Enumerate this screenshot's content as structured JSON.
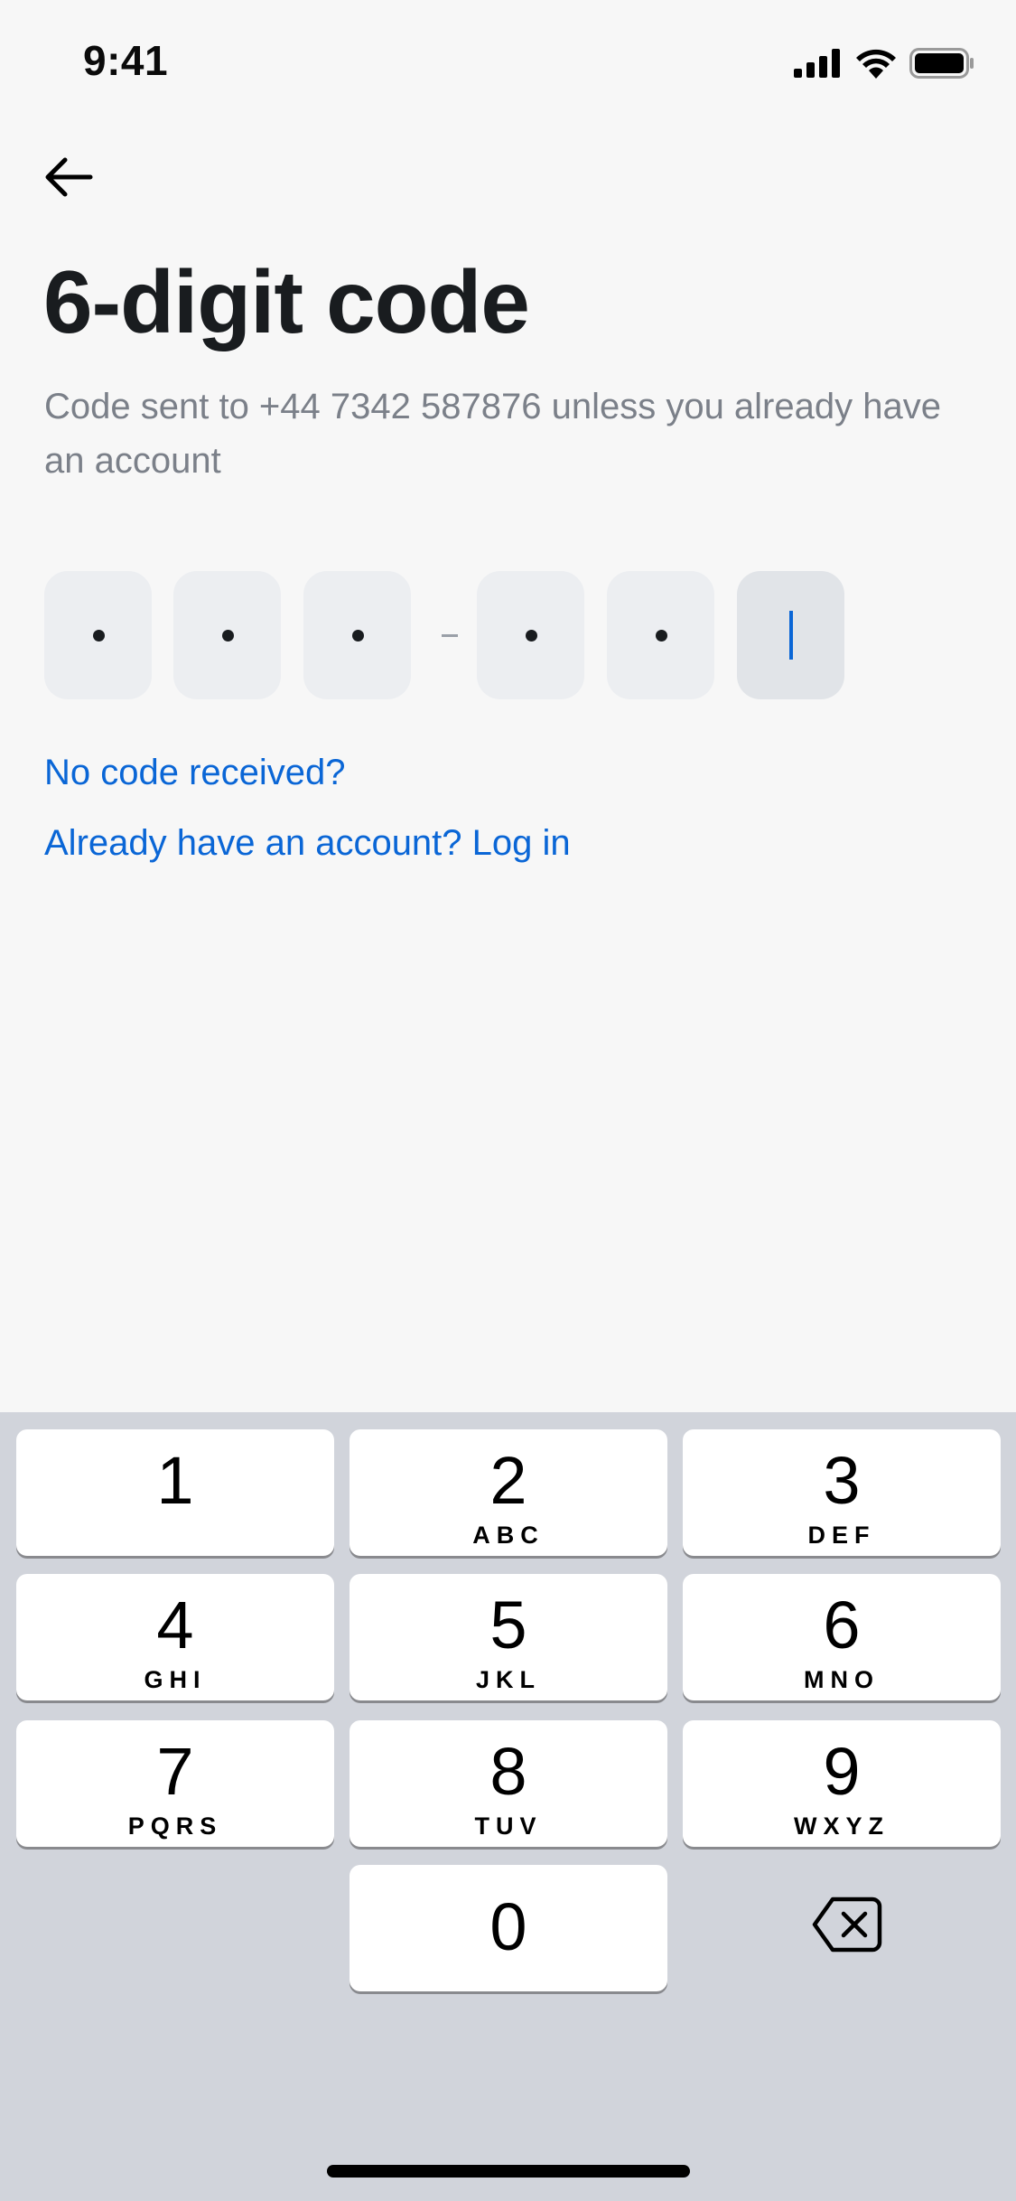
{
  "status_bar": {
    "time": "9:41"
  },
  "header": {
    "title": "6-digit code",
    "subtitle": "Code sent to +44 7342 587876 unless you already have an account"
  },
  "code_input": {
    "length": 6,
    "filled": 5,
    "placeholder_char": "•"
  },
  "links": {
    "no_code": "No code received?",
    "login": "Already have an account? Log in"
  },
  "keypad": {
    "keys": [
      {
        "digit": "1",
        "letters": ""
      },
      {
        "digit": "2",
        "letters": "ABC"
      },
      {
        "digit": "3",
        "letters": "DEF"
      },
      {
        "digit": "4",
        "letters": "GHI"
      },
      {
        "digit": "5",
        "letters": "JKL"
      },
      {
        "digit": "6",
        "letters": "MNO"
      },
      {
        "digit": "7",
        "letters": "PQRS"
      },
      {
        "digit": "8",
        "letters": "TUV"
      },
      {
        "digit": "9",
        "letters": "WXYZ"
      },
      {
        "digit": "0",
        "letters": ""
      }
    ]
  },
  "colors": {
    "accent": "#0a66d6",
    "background": "#f7f7f7",
    "keyboard_bg": "#d1d4db"
  }
}
